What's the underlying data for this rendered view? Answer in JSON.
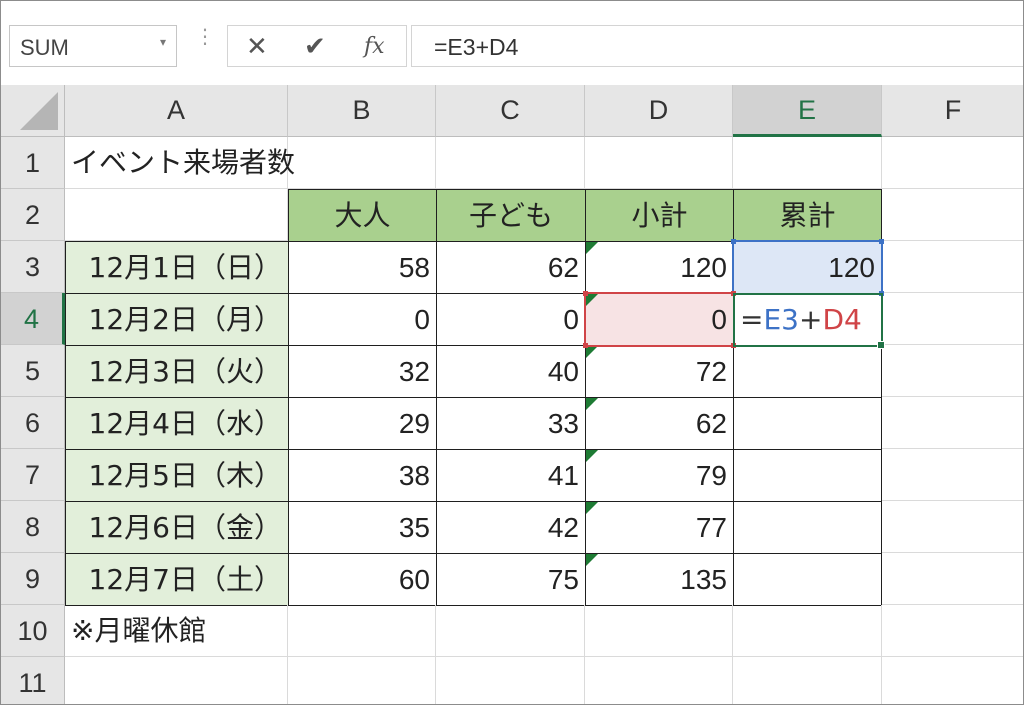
{
  "formula_bar": {
    "name_box": "SUM",
    "name_box_arrow": "▾",
    "cancel_icon": "✕",
    "enter_icon": "✔",
    "fx_label": "fx",
    "formula": "=E3+D4"
  },
  "columns": [
    "A",
    "B",
    "C",
    "D",
    "E",
    "F"
  ],
  "rows": [
    "1",
    "2",
    "3",
    "4",
    "5",
    "6",
    "7",
    "8",
    "9",
    "10",
    "11"
  ],
  "sheet": {
    "title": "イベント来場者数",
    "headers": [
      "大人",
      "子ども",
      "小計",
      "累計"
    ],
    "dates": [
      "12月1日（日）",
      "12月2日（月）",
      "12月3日（火）",
      "12月4日（水）",
      "12月5日（木）",
      "12月6日（金）",
      "12月7日（土）"
    ],
    "adults": [
      "58",
      "0",
      "32",
      "29",
      "38",
      "35",
      "60"
    ],
    "children": [
      "62",
      "0",
      "40",
      "33",
      "41",
      "42",
      "75"
    ],
    "subtotals": [
      "120",
      "0",
      "72",
      "62",
      "79",
      "77",
      "135"
    ],
    "cumulative_e3": "120",
    "edit_formula": {
      "eq": "=",
      "ref1": "E3",
      "op": "+",
      "ref2": "D4"
    },
    "note": "※月曜休館"
  },
  "selection": {
    "active_column": "E",
    "active_row": "4"
  },
  "colors": {
    "header_green": "#a9d08e",
    "date_green": "#e2efda",
    "excel_green": "#217346",
    "ref_blue": "#3d72c6",
    "ref_red": "#d04447"
  }
}
